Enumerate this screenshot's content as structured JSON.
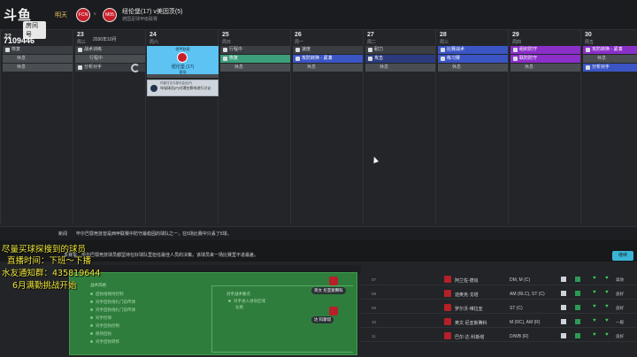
{
  "header": {
    "logo_text": "斗鱼",
    "logo_sub": "房间号",
    "room_id": "7109446",
    "tomorrow_label": "明天",
    "home_badge": "FCN",
    "away_badge": "M05",
    "match_title": "纽伦堡(17) v美因茨(5)",
    "match_sub": "德国足球甲级联赛",
    "date_label": "2030年10月"
  },
  "calendar": {
    "days": [
      {
        "num": "22",
        "name": "周二"
      },
      {
        "num": "23",
        "name": "周三"
      },
      {
        "num": "24",
        "name": "周六"
      },
      {
        "num": "25",
        "name": "周日"
      },
      {
        "num": "26",
        "name": "周一"
      },
      {
        "num": "27",
        "name": "周二"
      },
      {
        "num": "28",
        "name": "周三"
      },
      {
        "num": "29",
        "name": "周四"
      },
      {
        "num": "30",
        "name": "周五"
      }
    ],
    "slots": {
      "d0": [
        "恢复",
        "休息",
        "休息"
      ],
      "d1": [
        "战术训练",
        "行程中",
        "分析对手"
      ],
      "d3": [
        "行程中",
        "恢复",
        "休息"
      ],
      "d4": [
        "速度",
        "攻防转换 - 紧凑",
        "休息"
      ],
      "d5": [
        "耐力",
        "攻击",
        "休息"
      ],
      "d6": [
        "比赛战术",
        "练习赛",
        "休息"
      ],
      "d7": [
        "组织防守",
        "联防防守",
        "休息"
      ],
      "d8": [
        "攻防转换 - 紧凑",
        "休息",
        "分析对手"
      ]
    },
    "match_card": {
      "top": "德甲联赛",
      "name": "纽伦堡 (17)",
      "sub": "客场"
    },
    "news_card": {
      "head": "内部讨论与部长会议(P)",
      "text": "年轻球员(P)对潜在影响进行讨论"
    }
  },
  "ticker": {
    "label": "新闻",
    "text": "毕尔巴鄂竞技曾是西甲联赛中防守最稳固的球队之一，在5场比赛中只丢了5球。",
    "text2": "本赛季…毕尔巴鄂竞技球员都坚持在好球队里担任最佳人员的决策。该球员来一场比赛里不进最差。",
    "continue_label": "继续"
  },
  "overlay": {
    "line1": "尽量买球探搜到的球员",
    "line2": "直播时间：下班～下播",
    "line3": "水友通知群：435819644",
    "line4": "6月满勤挑战开始"
  },
  "tactics": {
    "header": "战术设置",
    "label_a": "战术风格",
    "label_b": "进攻侧重",
    "items": [
      "后防线保持控制",
      "对手后防线扎门前传球",
      "对手后防线扎门前传球",
      "对手控球",
      "对手后防控制",
      "保持后防",
      "对手后防转移"
    ],
    "right_label": "对手战术要点",
    "right_items": [
      "对手进入进攻区域",
      "左路"
    ],
    "player_a": "英文 尼亚斯腾科",
    "player_b": "达 科斯塔"
  },
  "players": [
    {
      "num": "07",
      "name": "阿兰佐·德肖",
      "pos": "DM, M (C)",
      "status": "高效"
    },
    {
      "num": "08",
      "name": "迪奥克·戈塔",
      "pos": "AM (RLC), ST (C)",
      "status": "良好"
    },
    {
      "num": "09",
      "name": "罗尔沃·维拉亚",
      "pos": "ST (C)",
      "status": "良好"
    },
    {
      "num": "10",
      "name": "英文·尼亚斯腾科",
      "pos": "M (RC), AM (R)",
      "status": "一般"
    },
    {
      "num": "11",
      "name": "巴尔·达·科斯塔",
      "pos": "D/WB (R)",
      "status": "良好"
    }
  ],
  "colors": {
    "match_card": "#5cc3f2",
    "green_slot": "#3c9e7a",
    "blue_slot": "#3b55c4",
    "purple_slot": "#8b2fc9",
    "overlay_text": "#f2e83a",
    "continue": "#3bb5d6"
  }
}
